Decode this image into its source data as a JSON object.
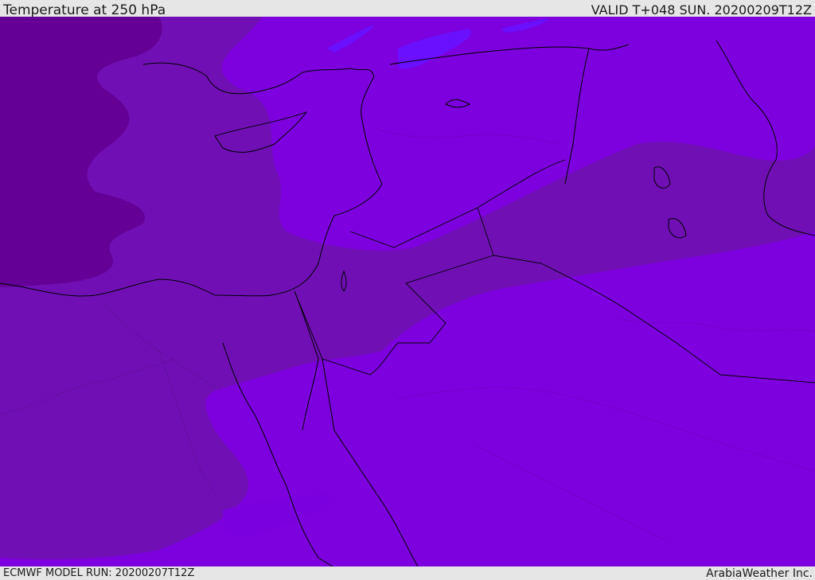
{
  "header": {
    "title": "Temperature at 250 hPa",
    "valid": "VALID T+048 SUN. 20200209T12Z"
  },
  "footer": {
    "model_run": "ECMWF MODEL RUN: 20200207T12Z",
    "credit": "ArabiaWeather Inc."
  },
  "map": {
    "field": "temperature",
    "level": "250 hPa",
    "colors": {
      "coldest_band": "#640096",
      "cold_band": "#7010b4",
      "mid_band": "#7a00dc",
      "warm_band": "#8000e6",
      "warmest_band": "#6a10ff",
      "coastline": "#000000"
    }
  }
}
